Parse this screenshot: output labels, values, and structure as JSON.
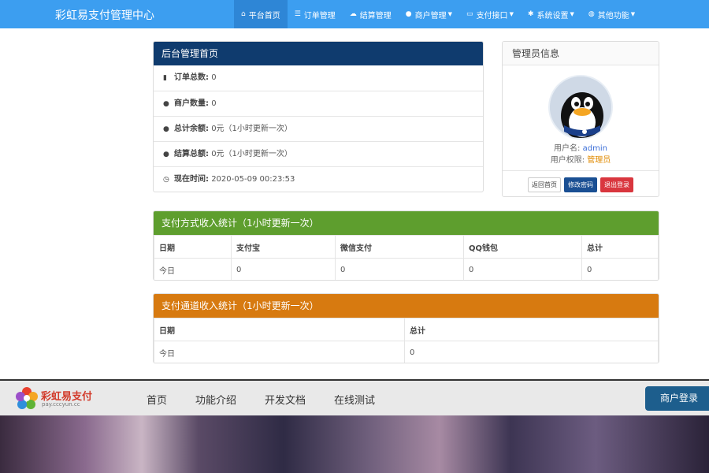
{
  "navbar": {
    "brand": "彩虹易支付管理中心",
    "items": [
      {
        "label": "平台首页",
        "icon": "home-icon"
      },
      {
        "label": "订单管理",
        "icon": "list-icon"
      },
      {
        "label": "结算管理",
        "icon": "cloud-icon"
      },
      {
        "label": "商户管理",
        "icon": "user-icon",
        "dropdown": true
      },
      {
        "label": "支付接口",
        "icon": "card-icon",
        "dropdown": true
      },
      {
        "label": "系统设置",
        "icon": "gear-icon",
        "dropdown": true
      },
      {
        "label": "其他功能",
        "icon": "globe-icon",
        "dropdown": true
      }
    ]
  },
  "dashboard": {
    "title": "后台管理首页",
    "rows": [
      {
        "label": "订单总数:",
        "value": "0",
        "icon": "bar-chart-icon"
      },
      {
        "label": "商户数量:",
        "value": "0",
        "icon": "drop-icon"
      },
      {
        "label": "总计余额:",
        "value": "0元（1小时更新一次）",
        "icon": "drop-icon"
      },
      {
        "label": "结算总额:",
        "value": "0元（1小时更新一次）",
        "icon": "drop-icon"
      },
      {
        "label": "现在时间:",
        "value": "2020-05-09 00:23:53",
        "icon": "clock-icon"
      }
    ]
  },
  "admin": {
    "title": "管理员信息",
    "username_label": "用户名:",
    "username": "admin",
    "role_label": "用户权限:",
    "role": "管理员",
    "buttons": [
      "返回首页",
      "修改密码",
      "退出登录"
    ]
  },
  "pay_method_stats": {
    "title": "支付方式收入统计（1小时更新一次）",
    "columns": [
      "日期",
      "支付宝",
      "微信支付",
      "QQ钱包",
      "总计"
    ],
    "rows": [
      [
        "今日",
        "0",
        "0",
        "0",
        "0"
      ]
    ]
  },
  "channel_stats": {
    "title": "支付通道收入统计（1小时更新一次）",
    "columns": [
      "日期",
      "总计"
    ],
    "rows": [
      [
        "今日",
        "0"
      ]
    ]
  },
  "site": {
    "logo_title": "彩虹易支付",
    "logo_sub": "pay.cccyun.cc",
    "nav": [
      "首页",
      "功能介绍",
      "开发文档",
      "在线测试"
    ],
    "login": "商户登录"
  },
  "colors": {
    "navbar": "#3c9ef0",
    "dashboard_head": "#0f3b6e",
    "pay_method_head": "#5e9e2e",
    "channel_head": "#d77a10"
  }
}
